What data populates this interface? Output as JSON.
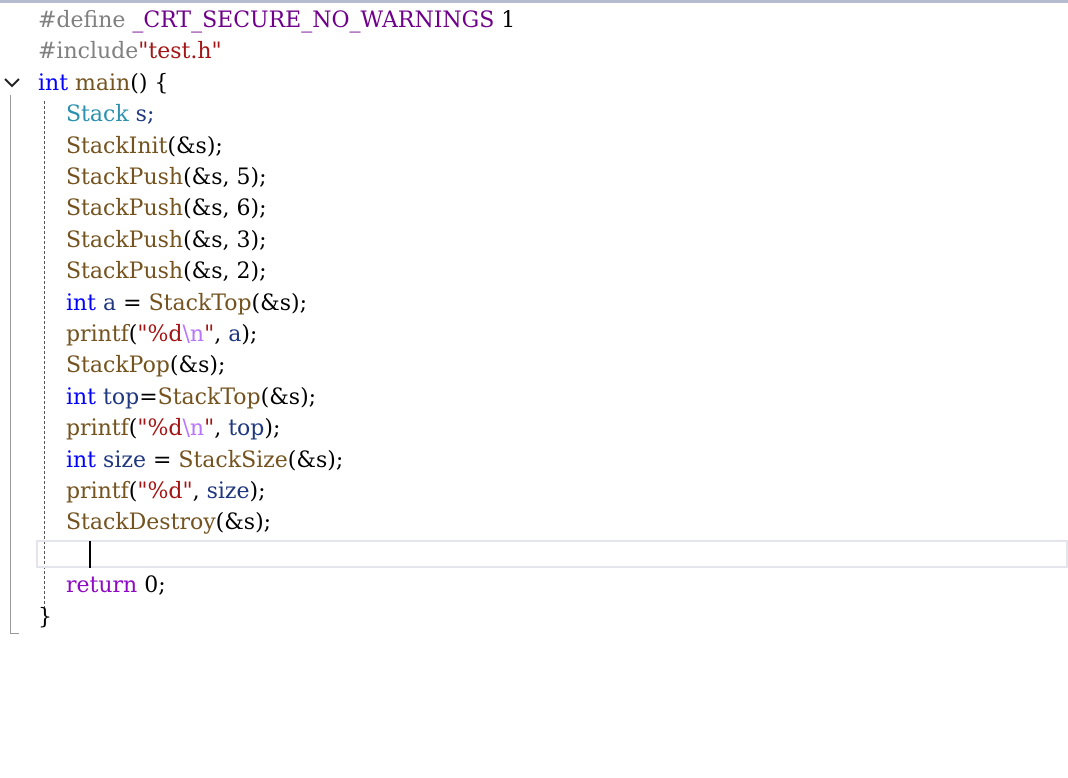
{
  "editor": {
    "lines": [
      [
        {
          "t": "#define ",
          "c": "t-pre"
        },
        {
          "t": "_CRT_SECURE_NO_WARNINGS",
          "c": "t-mac"
        },
        {
          "t": " 1",
          "c": "t-num"
        }
      ],
      [
        {
          "t": "#include",
          "c": "t-pre"
        },
        {
          "t": "\"test.h\"",
          "c": "t-str"
        }
      ],
      [
        {
          "t": "int",
          "c": "t-kw"
        },
        {
          "t": " main",
          "c": "t-fn"
        },
        {
          "t": "() {",
          "c": "t-punc"
        }
      ],
      [
        {
          "t": "    Stack",
          "c": "t-type"
        },
        {
          "t": " s;",
          "c": "t-param"
        }
      ],
      [
        {
          "t": "    StackInit",
          "c": "t-fn"
        },
        {
          "t": "(&s);",
          "c": "t-punc"
        }
      ],
      [
        {
          "t": "    StackPush",
          "c": "t-fn"
        },
        {
          "t": "(&s, 5);",
          "c": "t-punc"
        }
      ],
      [
        {
          "t": "    StackPush",
          "c": "t-fn"
        },
        {
          "t": "(&s, 6);",
          "c": "t-punc"
        }
      ],
      [
        {
          "t": "    StackPush",
          "c": "t-fn"
        },
        {
          "t": "(&s, 3);",
          "c": "t-punc"
        }
      ],
      [
        {
          "t": "    StackPush",
          "c": "t-fn"
        },
        {
          "t": "(&s, 2);",
          "c": "t-punc"
        }
      ],
      [
        {
          "t": "    int",
          "c": "t-kw"
        },
        {
          "t": " a",
          "c": "t-param"
        },
        {
          "t": " = ",
          "c": "t-punc"
        },
        {
          "t": "StackTop",
          "c": "t-fn"
        },
        {
          "t": "(&s);",
          "c": "t-punc"
        }
      ],
      [
        {
          "t": "    printf",
          "c": "t-fn"
        },
        {
          "t": "(",
          "c": "t-punc"
        },
        {
          "t": "\"%d",
          "c": "t-str"
        },
        {
          "t": "\\n",
          "c": "t-esc"
        },
        {
          "t": "\"",
          "c": "t-str"
        },
        {
          "t": ", ",
          "c": "t-punc"
        },
        {
          "t": "a",
          "c": "t-param"
        },
        {
          "t": ");",
          "c": "t-punc"
        }
      ],
      [
        {
          "t": "    StackPop",
          "c": "t-fn"
        },
        {
          "t": "(&s);",
          "c": "t-punc"
        }
      ],
      [
        {
          "t": "    int",
          "c": "t-kw"
        },
        {
          "t": " top",
          "c": "t-param"
        },
        {
          "t": "=",
          "c": "t-punc"
        },
        {
          "t": "StackTop",
          "c": "t-fn"
        },
        {
          "t": "(&s);",
          "c": "t-punc"
        }
      ],
      [
        {
          "t": "    printf",
          "c": "t-fn"
        },
        {
          "t": "(",
          "c": "t-punc"
        },
        {
          "t": "\"%d",
          "c": "t-str"
        },
        {
          "t": "\\n",
          "c": "t-esc"
        },
        {
          "t": "\"",
          "c": "t-str"
        },
        {
          "t": ", ",
          "c": "t-punc"
        },
        {
          "t": "top",
          "c": "t-param"
        },
        {
          "t": ");",
          "c": "t-punc"
        }
      ],
      [
        {
          "t": "    int",
          "c": "t-kw"
        },
        {
          "t": " size",
          "c": "t-param"
        },
        {
          "t": " = ",
          "c": "t-punc"
        },
        {
          "t": "StackSize",
          "c": "t-fn"
        },
        {
          "t": "(&s);",
          "c": "t-punc"
        }
      ],
      [
        {
          "t": "    printf",
          "c": "t-fn"
        },
        {
          "t": "(",
          "c": "t-punc"
        },
        {
          "t": "\"%d\"",
          "c": "t-str"
        },
        {
          "t": ", ",
          "c": "t-punc"
        },
        {
          "t": "size",
          "c": "t-param"
        },
        {
          "t": ");",
          "c": "t-punc"
        }
      ],
      [
        {
          "t": "    StackDestroy",
          "c": "t-fn"
        },
        {
          "t": "(&s);",
          "c": "t-punc"
        }
      ],
      [
        {
          "t": "",
          "c": "t-punc"
        }
      ],
      [
        {
          "t": "    return",
          "c": "t-ctrl"
        },
        {
          "t": " 0;",
          "c": "t-punc"
        }
      ],
      [
        {
          "t": "}",
          "c": "t-punc"
        }
      ]
    ]
  }
}
